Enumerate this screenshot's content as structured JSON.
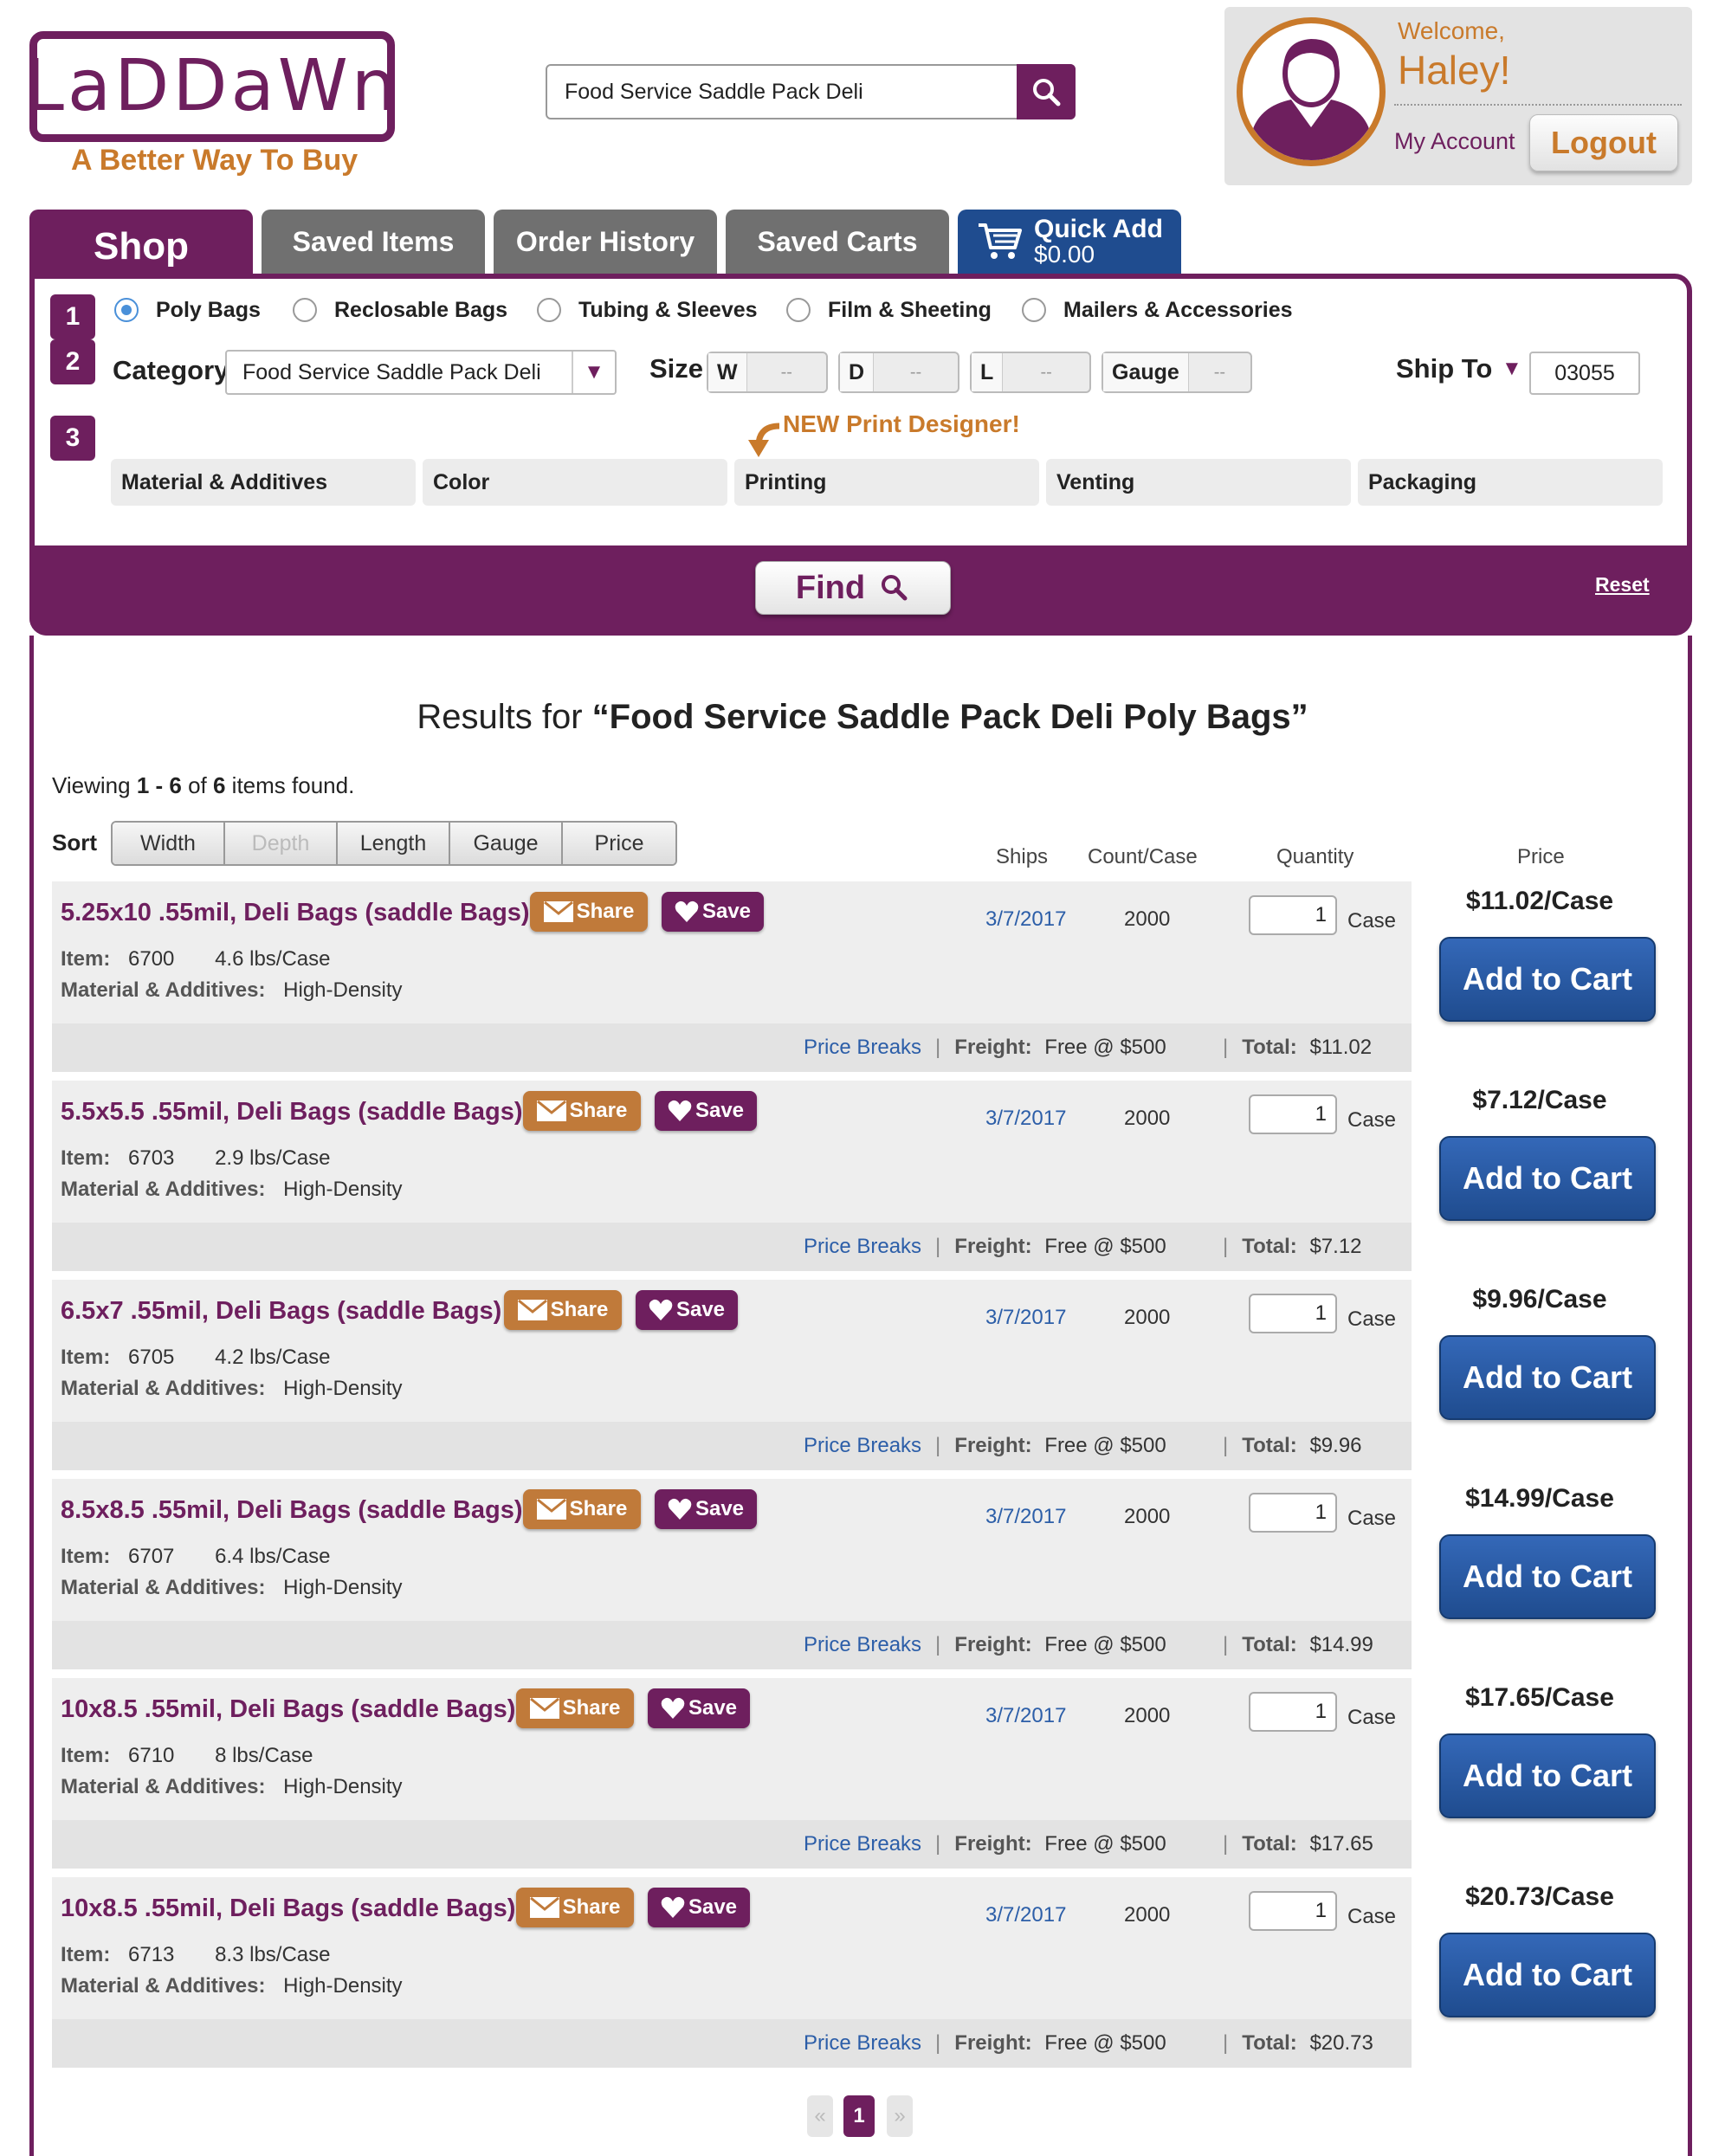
{
  "brand": {
    "logo": "LaDDaWn",
    "tagline": "A Better Way To Buy",
    "purple": "#6e1f5e",
    "orange": "#c97a2b",
    "blue": "#1f4c8f"
  },
  "search": {
    "value": "Food Service Saddle Pack Deli",
    "icon": "search-icon"
  },
  "account": {
    "welcome": "Welcome,",
    "name": "Haley!",
    "my_account": "My Account",
    "logout": "Logout"
  },
  "tabs": {
    "shop": "Shop",
    "saved_items": "Saved Items",
    "order_history": "Order History",
    "saved_carts": "Saved Carts",
    "quick_add": "Quick Add",
    "quick_add_amount": "$0.00"
  },
  "filters": {
    "step1": "1",
    "step2": "2",
    "step3": "3",
    "types": [
      "Poly Bags",
      "Reclosable Bags",
      "Tubing & Sleeves",
      "Film & Sheeting",
      "Mailers & Accessories"
    ],
    "selected_type": "Poly Bags",
    "category_label": "Category",
    "category_value": "Food Service Saddle Pack Deli",
    "size_label": "Size",
    "size_w": "W",
    "size_d": "D",
    "size_l": "L",
    "size_gauge": "Gauge",
    "size_empty": "--",
    "ship_to_label": "Ship To",
    "ship_to_value": "03055",
    "print_note": "NEW Print Designer!",
    "attributes": [
      "Material & Additives",
      "Color",
      "Printing",
      "Venting",
      "Packaging"
    ],
    "find": "Find",
    "reset": "Reset"
  },
  "results": {
    "prefix": "Results for ",
    "query": "“Food Service Saddle Pack Deli Poly Bags”",
    "viewing_prefix": "Viewing ",
    "range": "1 - 6",
    "of": " of ",
    "total": "6",
    "suffix": " items found.",
    "sort_label": "Sort",
    "sort_options": [
      "Width",
      "Depth",
      "Length",
      "Gauge",
      "Price"
    ],
    "columns": {
      "ships": "Ships",
      "count": "Count/Case",
      "quantity": "Quantity",
      "price": "Price"
    }
  },
  "labels": {
    "share": "Share",
    "save": "Save",
    "item": "Item:",
    "material": "Material & Additives:",
    "case": "Case",
    "price_breaks": "Price Breaks",
    "freight": "Freight:",
    "freight_value": "Free @ $500",
    "total": "Total:",
    "add_to_cart": "Add to Cart"
  },
  "products": [
    {
      "title": "5.25x10 .55mil, Deli Bags (saddle Bags)",
      "item": "6700",
      "weight": "4.6 lbs/Case",
      "material": "High-Density",
      "ships": "3/7/2017",
      "count": "2000",
      "qty": "1",
      "price": "$11.02/Case",
      "total": "$11.02"
    },
    {
      "title": "5.5x5.5 .55mil, Deli Bags (saddle Bags)",
      "item": "6703",
      "weight": "2.9 lbs/Case",
      "material": "High-Density",
      "ships": "3/7/2017",
      "count": "2000",
      "qty": "1",
      "price": "$7.12/Case",
      "total": "$7.12"
    },
    {
      "title": "6.5x7 .55mil, Deli Bags (saddle Bags)",
      "item": "6705",
      "weight": "4.2 lbs/Case",
      "material": "High-Density",
      "ships": "3/7/2017",
      "count": "2000",
      "qty": "1",
      "price": "$9.96/Case",
      "total": "$9.96"
    },
    {
      "title": "8.5x8.5 .55mil, Deli Bags (saddle Bags)",
      "item": "6707",
      "weight": "6.4 lbs/Case",
      "material": "High-Density",
      "ships": "3/7/2017",
      "count": "2000",
      "qty": "1",
      "price": "$14.99/Case",
      "total": "$14.99"
    },
    {
      "title": "10x8.5 .55mil, Deli Bags (saddle Bags)",
      "item": "6710",
      "weight": "8 lbs/Case",
      "material": "High-Density",
      "ships": "3/7/2017",
      "count": "2000",
      "qty": "1",
      "price": "$17.65/Case",
      "total": "$17.65"
    },
    {
      "title": "10x8.5 .55mil, Deli Bags (saddle Bags)",
      "item": "6713",
      "weight": "8.3 lbs/Case",
      "material": "High-Density",
      "ships": "3/7/2017",
      "count": "2000",
      "qty": "1",
      "price": "$20.73/Case",
      "total": "$20.73"
    }
  ],
  "pagination": {
    "prev": "«",
    "current": "1",
    "next": "»"
  }
}
